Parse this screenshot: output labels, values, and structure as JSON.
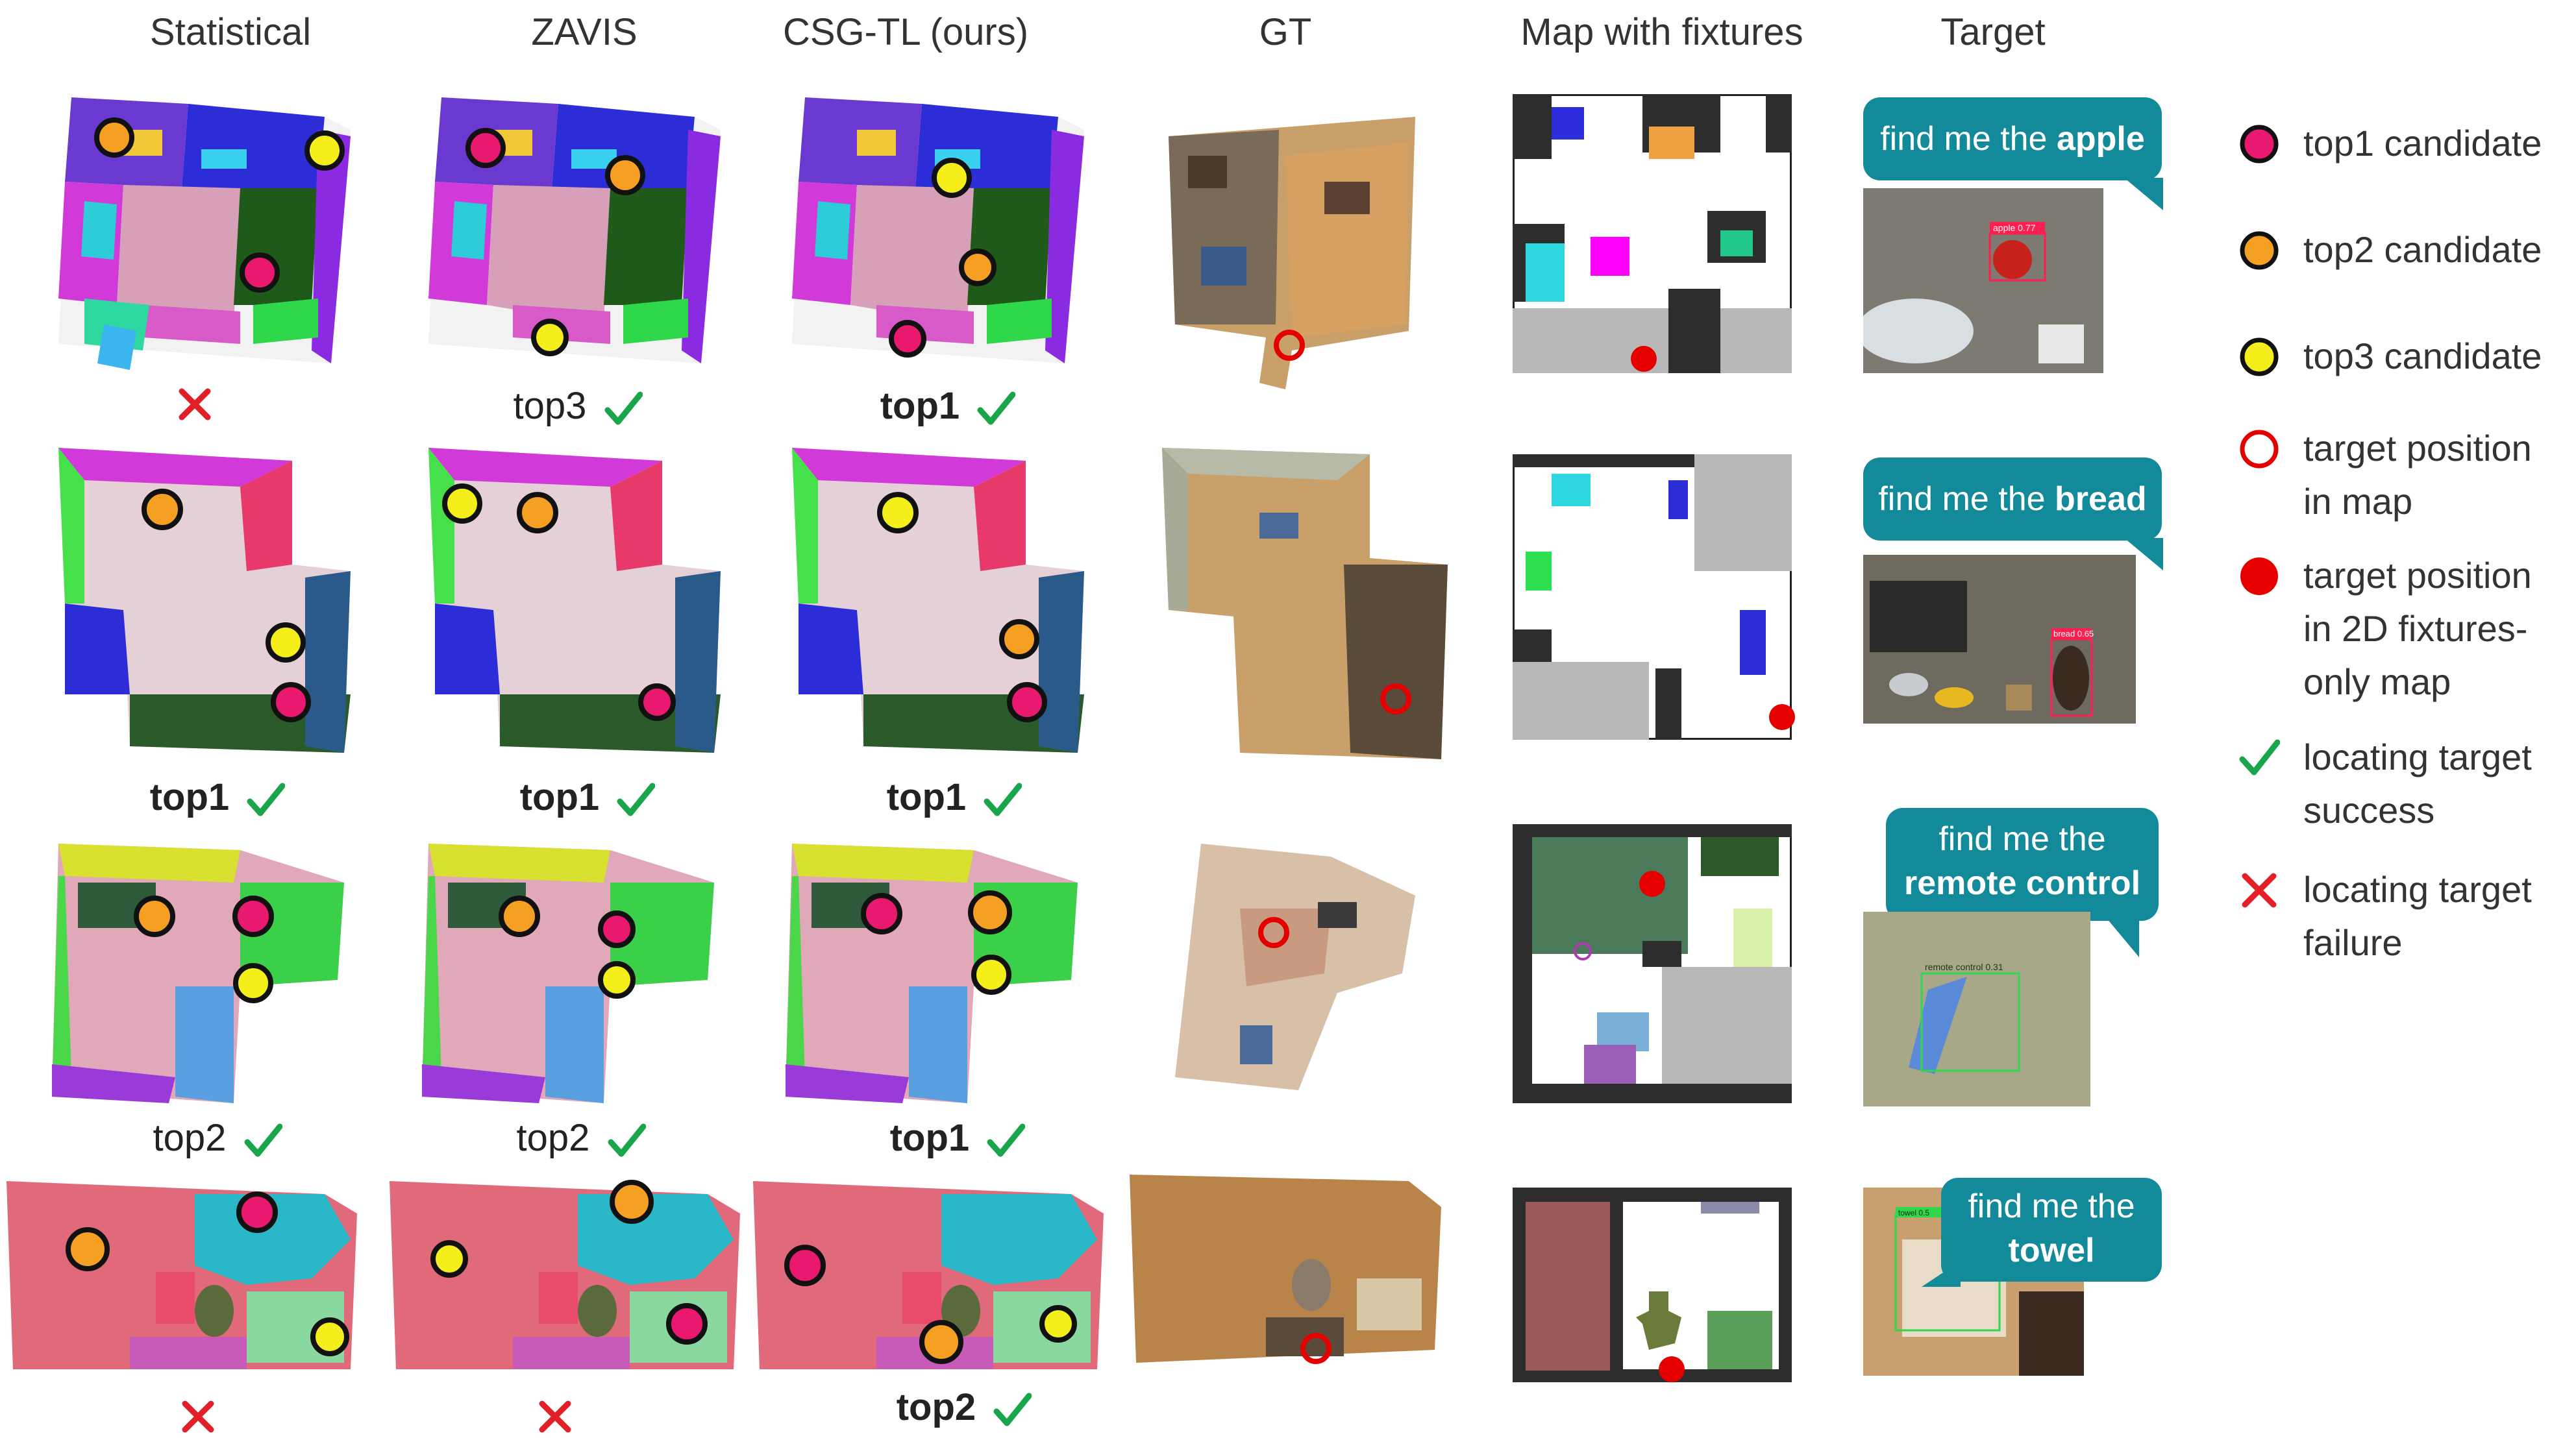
{
  "columns": [
    "Statistical",
    "ZAVIS",
    "CSG-TL (ours)",
    "GT",
    "Map with fixtures",
    "Target"
  ],
  "rows": [
    {
      "results": [
        {
          "text": "",
          "bold": false,
          "success": false
        },
        {
          "text": "top3",
          "bold": false,
          "success": true
        },
        {
          "text": "top1",
          "bold": true,
          "success": true
        }
      ],
      "query": {
        "prefix": "find me the ",
        "object": "apple"
      },
      "detection": "apple 0.77"
    },
    {
      "results": [
        {
          "text": "top1",
          "bold": true,
          "success": true
        },
        {
          "text": "top1",
          "bold": true,
          "success": true
        },
        {
          "text": "top1",
          "bold": true,
          "success": true
        }
      ],
      "query": {
        "prefix": "find me the ",
        "object": "bread"
      },
      "detection": "bread 0.65"
    },
    {
      "results": [
        {
          "text": "top2",
          "bold": false,
          "success": true
        },
        {
          "text": "top2",
          "bold": false,
          "success": true
        },
        {
          "text": "top1",
          "bold": true,
          "success": true
        }
      ],
      "query": {
        "prefix": "find me the",
        "object": "remote control"
      },
      "detection": "remote control 0.31"
    },
    {
      "results": [
        {
          "text": "",
          "bold": false,
          "success": false
        },
        {
          "text": "",
          "bold": false,
          "success": false
        },
        {
          "text": "top2",
          "bold": true,
          "success": true
        }
      ],
      "query": {
        "prefix": "find me the",
        "object": "towel"
      },
      "detection": "towel 0.5"
    }
  ],
  "legend": [
    {
      "symbol": "top1-marker",
      "lines": [
        "top1 candidate"
      ]
    },
    {
      "symbol": "top2-marker",
      "lines": [
        "top2 candidate"
      ]
    },
    {
      "symbol": "top3-marker",
      "lines": [
        "top3 candidate"
      ]
    },
    {
      "symbol": "target-ring",
      "lines": [
        "target position",
        "in map"
      ]
    },
    {
      "symbol": "target-dot",
      "lines": [
        "target position",
        "in 2D fixtures-",
        "only map"
      ]
    },
    {
      "symbol": "check-mark",
      "lines": [
        "locating target",
        "success"
      ]
    },
    {
      "symbol": "cross-mark",
      "lines": [
        "locating target",
        "failure"
      ]
    }
  ],
  "colors": {
    "top1": "#e8196e",
    "top2": "#f5a023",
    "top3": "#f4ee1a",
    "success": "#19a64b",
    "failure": "#e21f26",
    "target": "#e50000",
    "bubble": "#138a9a"
  }
}
